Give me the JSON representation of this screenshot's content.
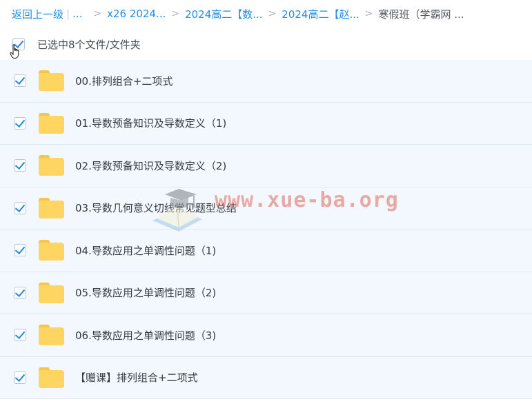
{
  "breadcrumb": {
    "back_label": "返回上一级",
    "ellipsis": "...",
    "items": [
      "x26 2024...",
      "2024高二【数...",
      "2024高二【赵..."
    ],
    "current": "寒假班（学霸网 ..."
  },
  "selection": {
    "label": "已选中8个文件/文件夹",
    "checked": true
  },
  "files": [
    {
      "name": "00.排列组合+二项式",
      "type": "folder",
      "checked": true
    },
    {
      "name": "01.导数预备知识及导数定义（1)",
      "type": "folder",
      "checked": true
    },
    {
      "name": "02.导数预备知识及导数定义（2)",
      "type": "folder",
      "checked": true
    },
    {
      "name": "03.导数几何意义切线常见题型总结",
      "type": "folder",
      "checked": true
    },
    {
      "name": "04.导数应用之单调性问题（1)",
      "type": "folder",
      "checked": true
    },
    {
      "name": "05.导数应用之单调性问题（2)",
      "type": "folder",
      "checked": true
    },
    {
      "name": "06.导数应用之单调性问题（3)",
      "type": "folder",
      "checked": true
    },
    {
      "name": "【赠课】排列组合+二项式",
      "type": "folder",
      "checked": true
    }
  ],
  "watermark": {
    "text": "www.xue-ba.org",
    "icon": "graduation-cap-book-icon"
  },
  "colors": {
    "link": "#1f8fe8",
    "row_background": "#f3f8fe",
    "check_blue": "#1e88e5",
    "folder_yellow": "#fdd560"
  }
}
